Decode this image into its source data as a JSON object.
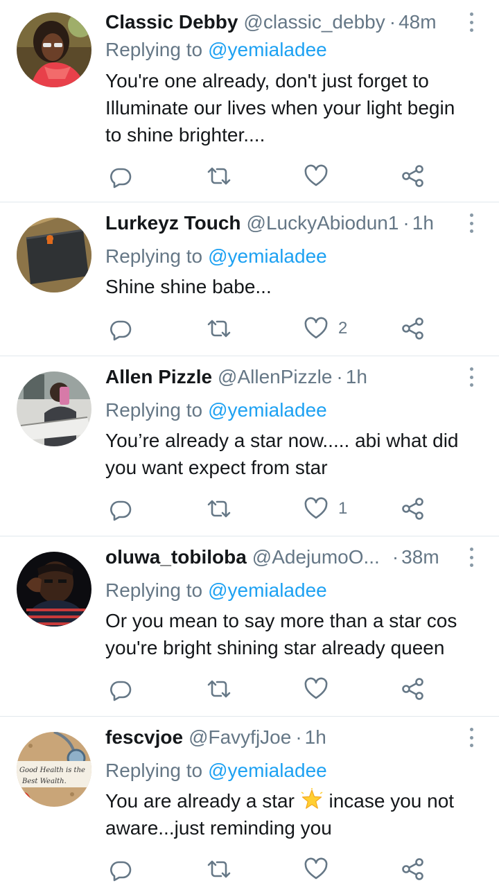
{
  "reply_prefix": "Replying to",
  "tweets": [
    {
      "name": "Classic Debby",
      "handle": "@classic_debby",
      "separator": "·",
      "time": "48m",
      "replying_to": "@yemialadee",
      "text": "You're one already, don't just forget to\nIlluminate our lives when your light begin\nto shine brighter....",
      "like_count": ""
    },
    {
      "name": "Lurkeyz Touch",
      "handle": "@LuckyAbiodun1",
      "separator": "·",
      "time": "1h",
      "replying_to": "@yemialadee",
      "text": "Shine shine babe...",
      "like_count": "2"
    },
    {
      "name": "Allen Pizzle",
      "handle": "@AllenPizzle",
      "separator": "·",
      "time": "1h",
      "replying_to": "@yemialadee",
      "text": "You’re already a star now..... abi what did\nyou want expect from star",
      "like_count": "1"
    },
    {
      "name": "oluwa_tobiloba",
      "handle": "@AdejumoO...",
      "separator": "·",
      "time": "38m",
      "replying_to": "@yemialadee",
      "text": "Or you mean to say more than a star cos\nyou're bright shining star already queen",
      "like_count": ""
    },
    {
      "name": "fescvjoe",
      "handle": "@FavyfjJoe",
      "separator": "·",
      "time": "1h",
      "replying_to": "@yemialadee",
      "text_before": "You are already a star",
      "text_after": "incase you not\naware...just reminding you",
      "like_count": "",
      "avatar_text_1": "Good Health is the",
      "avatar_text_2": "Best Wealth."
    }
  ],
  "icons": {
    "reply": "reply-icon",
    "retweet": "retweet-icon",
    "like": "heart-icon",
    "share": "share-icon",
    "more": "more-vertical-icon",
    "emoji": "glowing-star-emoji"
  },
  "colors": {
    "link": "#1da1f2",
    "secondary": "#657786",
    "text": "#14171a",
    "divider": "#e1e8ed"
  }
}
